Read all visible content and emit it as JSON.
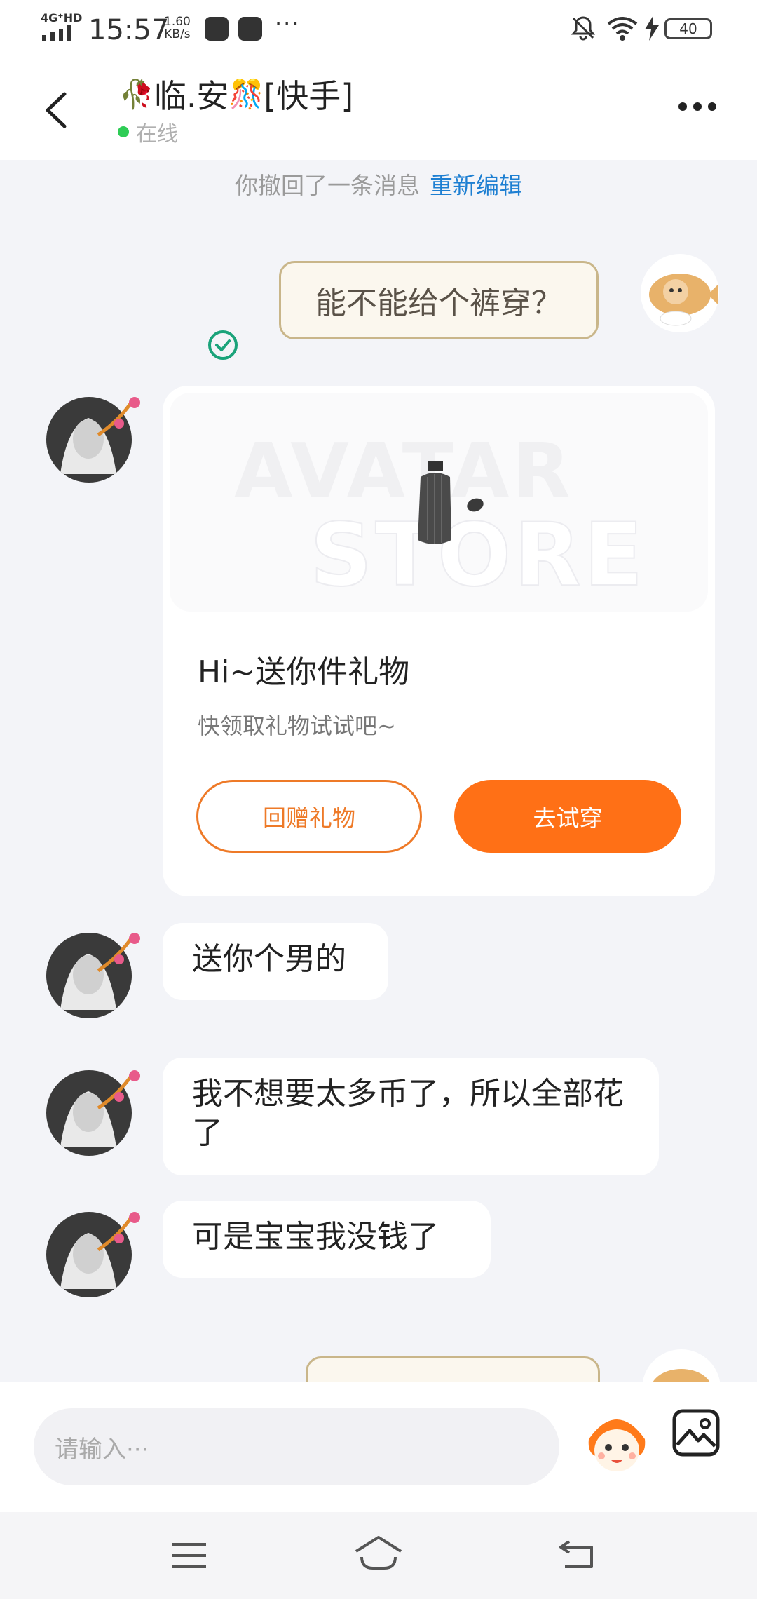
{
  "status_bar": {
    "network": "4G⁺HD",
    "time": "15:57",
    "speed_value": "1.60",
    "speed_unit": "KB/s",
    "more": "···",
    "battery": "40"
  },
  "header": {
    "title": "临.安",
    "emoji_left": "🥀",
    "emoji_right": "🎊",
    "suffix": "[快手]",
    "status": "在线"
  },
  "chat": {
    "recall_notice": "你撤回了一条消息",
    "recall_edit": "重新编辑",
    "my_message": "能不能给个裤穿？",
    "gift_card": {
      "watermark_1": "AVATAR",
      "watermark_2": "STORE",
      "title": "Hi~送你件礼物",
      "subtitle": "快领取礼物试试吧~",
      "return_label": "回赠礼物",
      "try_label": "去试穿"
    },
    "messages": [
      "送你个男的",
      "我不想要太多币了，所以全部花了",
      "可是宝宝我没钱了"
    ]
  },
  "input": {
    "placeholder": "请输入···"
  },
  "colors": {
    "accent_orange": "#ff7016",
    "link_blue": "#1d7fd2",
    "online_green": "#2ecc55",
    "background": "#f3f4f8"
  },
  "icons": [
    "back-arrow-icon",
    "more-icon",
    "check-circle-icon",
    "emoji-mascot-icon",
    "image-icon",
    "menu-icon",
    "home-icon",
    "return-icon"
  ]
}
